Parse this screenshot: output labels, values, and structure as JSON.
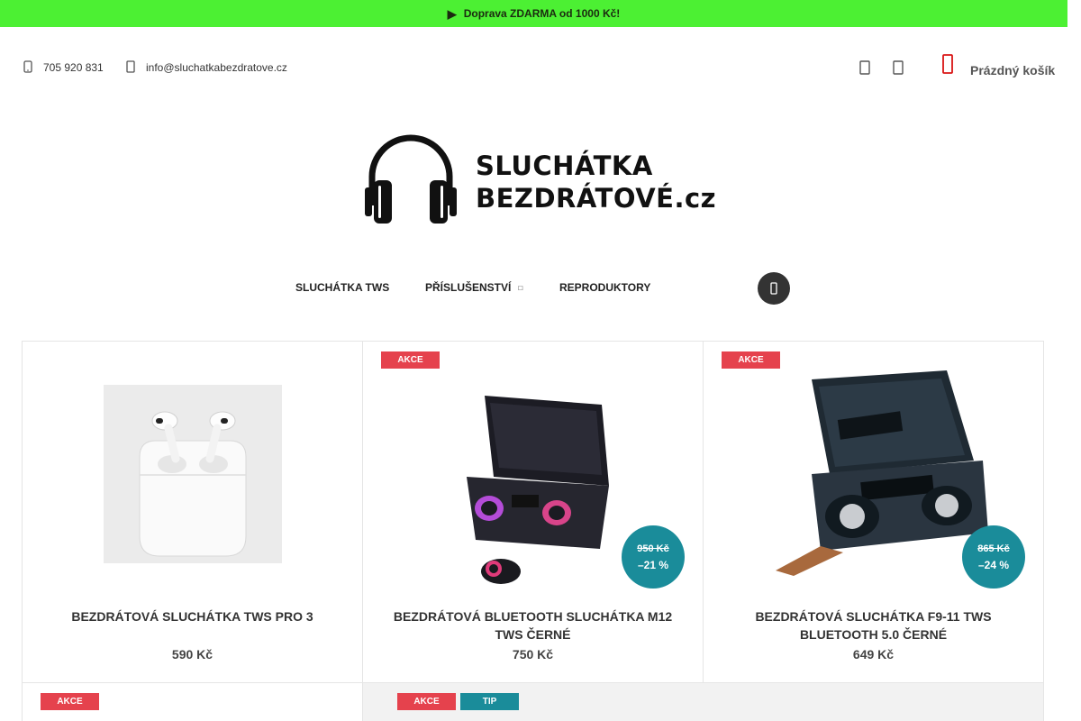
{
  "topbar": {
    "icon": "truck-icon",
    "text": "Doprava ZDARMA od 1000 Kč!",
    "bg": "#4cf033"
  },
  "contact": {
    "phone": "705 920 831",
    "email": "info@sluchatkabezdratove.cz"
  },
  "header": {
    "user_icon": "user-icon",
    "favorite_icon": "heart-icon",
    "cart_icon": "cart-icon",
    "cart_label": "Prázdný košík",
    "cart_color": "#d91414"
  },
  "logo": {
    "line1": "SLUCHÁTKA",
    "line2": "BEZDRÁTOVÉ.cz"
  },
  "nav": {
    "items": [
      "SLUCHÁTKA TWS",
      "PŘÍSLUŠENSTVÍ",
      "REPRODUKTORY"
    ],
    "search_icon": "search-icon"
  },
  "products": [
    {
      "name": "BEZDRÁTOVÁ SLUCHÁTKA TWS PRO 3",
      "price": "590 Kč",
      "flags": []
    },
    {
      "name": "BEZDRÁTOVÁ BLUETOOTH SLUCHÁTKA M12 TWS ČERNÉ",
      "price": "750 Kč",
      "flags": [
        "AKCE"
      ],
      "old_price": "950 Kč",
      "discount": "–21 %"
    },
    {
      "name": "BEZDRÁTOVÁ SLUCHÁTKA F9-11 TWS BLUETOOTH 5.0 ČERNÉ",
      "price": "649 Kč",
      "flags": [
        "AKCE"
      ],
      "old_price": "865 Kč",
      "discount": "–24 %"
    },
    {
      "flags": [
        "AKCE"
      ]
    },
    {
      "flags": [
        "AKCE",
        "TIP"
      ]
    }
  ],
  "colors": {
    "akce": "#e5424d",
    "tip": "#1a8c9a",
    "discount_badge": "#1a8c9a"
  }
}
